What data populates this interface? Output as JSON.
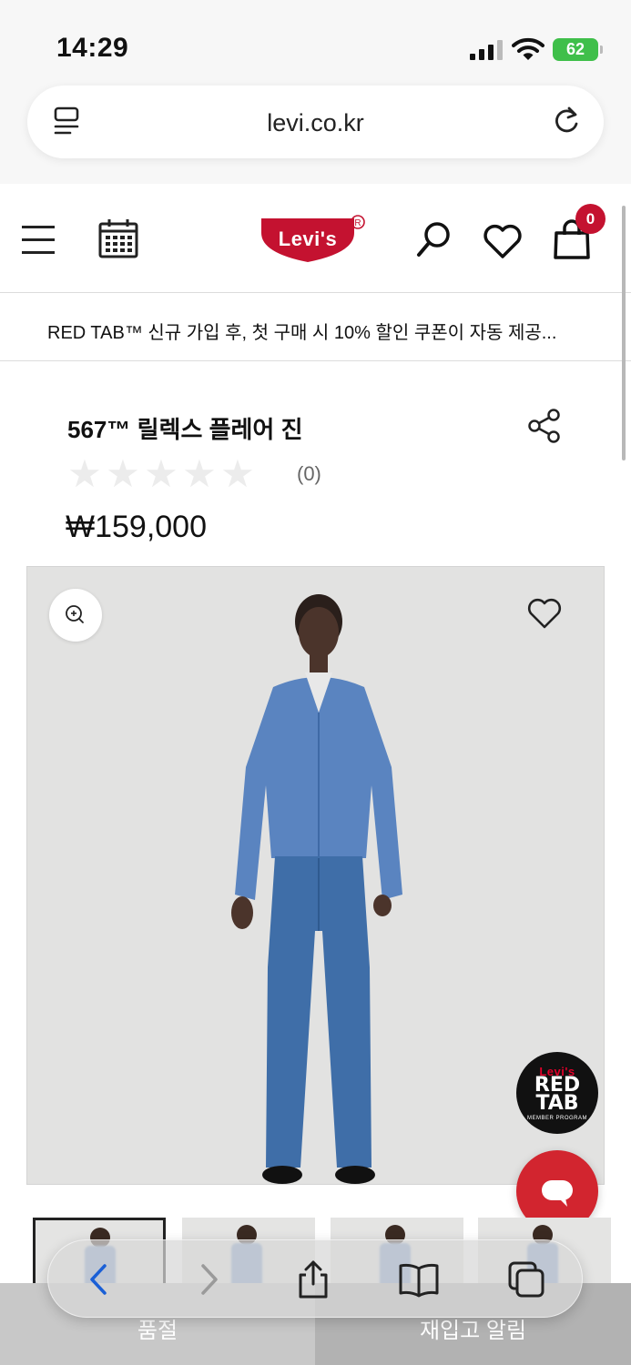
{
  "status_bar": {
    "time": "14:29",
    "battery": "62"
  },
  "browser": {
    "url": "levi.co.kr"
  },
  "header": {
    "logo_text": "Levi's",
    "cart_count": "0"
  },
  "promo": {
    "text": "RED TAB™ 신규 가입 후, 첫 구매 시 10% 할인 쿠폰이 자동 제공..."
  },
  "product": {
    "title": "567™ 릴렉스 플레어 진",
    "rating_stars": 0,
    "review_count": "(0)",
    "price": "₩159,000",
    "thumbnail_count": 4
  },
  "badge": {
    "brand": "Levi's",
    "name": "RED TAB",
    "program": "MEMBER PROGRAM"
  },
  "actions": {
    "sold_out": "품절",
    "restock_alert": "재입고 알림"
  },
  "colors": {
    "brand_red": "#c41230",
    "chat_red": "#d2252f",
    "battery_green": "#3fbf4a"
  }
}
